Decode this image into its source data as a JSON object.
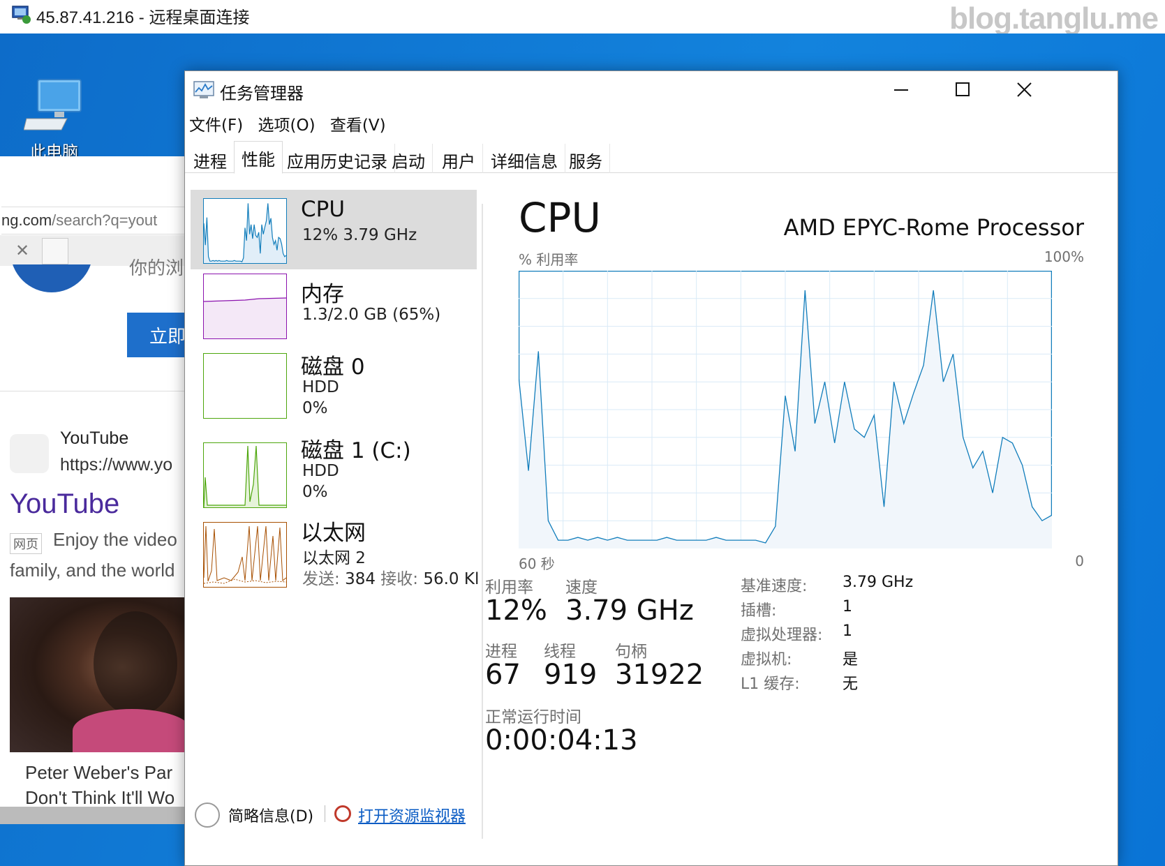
{
  "rdp": {
    "title": "45.87.41.216 - 远程桌面连接",
    "watermark": "blog.tanglu.me"
  },
  "desktop": {
    "icon_label": "此电脑"
  },
  "browser": {
    "url_domain": "ng.com",
    "url_rest": "/search?q=yout",
    "obscured_text": "你的浏",
    "cta": "立即",
    "result_site_name": "YouTube",
    "result_site_url": "https://www.yo",
    "result_title": "YouTube",
    "result_tag": "网页",
    "result_desc_1": "Enjoy the video",
    "result_desc_2": "family, and the world",
    "video_caption_1": "Peter Weber's Par",
    "video_caption_2": "Don't Think It'll Wo"
  },
  "taskmgr": {
    "title": "任务管理器",
    "menu": [
      "文件(F)",
      "选项(O)",
      "查看(V)"
    ],
    "tabs": [
      "进程",
      "性能",
      "应用历史记录",
      "启动",
      "用户",
      "详细信息",
      "服务"
    ],
    "active_tab": "性能",
    "resources": [
      {
        "name": "CPU",
        "sub1": "12%  3.79 GHz",
        "color": "#117dbb"
      },
      {
        "name": "内存",
        "sub1": "1.3/2.0 GB (65%)",
        "color": "#8b12ae"
      },
      {
        "name": "磁盘 0",
        "sub1": "HDD",
        "sub2": "0%",
        "color": "#4da60c"
      },
      {
        "name": "磁盘 1 (C:)",
        "sub1": "HDD",
        "sub2": "0%",
        "color": "#4da60c"
      },
      {
        "name": "以太网",
        "sub1": "以太网 2",
        "sub2_label_send": "发送:",
        "sub2_send": "384",
        "sub2_label_recv": "接收:",
        "sub2_recv": "56.0 Kl",
        "color": "#a74f01"
      }
    ],
    "detail": {
      "title": "CPU",
      "model": "AMD EPYC-Rome Processor",
      "y_label": "% 利用率",
      "y_max": "100%",
      "x_left": "60 秒",
      "x_right": "0",
      "utilization_label": "利用率",
      "utilization": "12%",
      "speed_label": "速度",
      "speed": "3.79 GHz",
      "processes_label": "进程",
      "processes": "67",
      "threads_label": "线程",
      "threads": "919",
      "handles_label": "句柄",
      "handles": "31922",
      "uptime_label": "正常运行时间",
      "uptime": "0:00:04:13",
      "specs": [
        {
          "k": "基准速度:",
          "v": "3.79 GHz"
        },
        {
          "k": "插槽:",
          "v": "1"
        },
        {
          "k": "虚拟处理器:",
          "v": "1"
        },
        {
          "k": "虚拟机:",
          "v": "是"
        },
        {
          "k": "L1 缓存:",
          "v": "无"
        }
      ]
    },
    "footer": {
      "fewer": "简略信息(D)",
      "open_monitor": "打开资源监视器"
    }
  },
  "chart_data": {
    "type": "area",
    "title": "CPU",
    "ylabel": "% 利用率",
    "xlabel": "60 秒",
    "ylim": [
      0,
      100
    ],
    "series": [
      {
        "values": [
          62,
          28,
          71,
          10,
          3,
          3,
          4,
          3,
          4,
          3,
          4,
          3,
          3,
          3,
          3,
          4,
          3,
          3,
          3,
          3,
          4,
          3,
          3,
          3,
          3,
          2,
          8,
          55,
          35,
          93,
          45,
          60,
          38,
          60,
          43,
          40,
          48,
          15,
          60,
          45,
          56,
          66,
          93,
          60,
          70,
          40,
          29,
          35,
          20,
          40,
          38,
          30,
          15,
          10,
          12
        ]
      }
    ],
    "color": "#117dbb",
    "grid": true
  }
}
